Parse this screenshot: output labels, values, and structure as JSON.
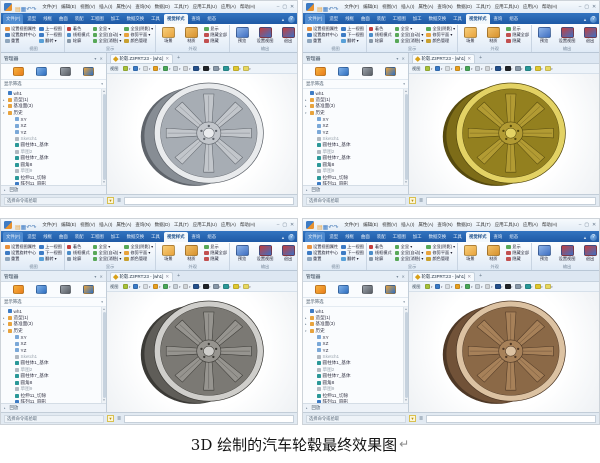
{
  "caption": {
    "text": "3D 绘制的汽车轮毂最终效果图",
    "return_mark": "↵"
  },
  "cad": {
    "quick_access": [
      {
        "name": "new-file-icon",
        "glyph": "▤",
        "color": "#e8a33d"
      },
      {
        "name": "save-icon",
        "glyph": "▦",
        "color": "#3d7bc4"
      },
      {
        "name": "undo-icon",
        "glyph": "↶",
        "color": "#4a7db8"
      },
      {
        "name": "redo-icon",
        "glyph": "↷",
        "color": "#4a7db8"
      }
    ],
    "menu": {
      "items": [
        "文件(F)",
        "编辑(E)",
        "视图(V)",
        "插入(I)",
        "属性(A)",
        "查询(N)",
        "数据(D)",
        "工具(T)",
        "应用工具(U)",
        "应用(A)",
        "帮助(H)"
      ]
    },
    "window_controls": [
      {
        "name": "minimize-button",
        "glyph": "–"
      },
      {
        "name": "maximize-button",
        "glyph": "▢"
      },
      {
        "name": "close-button",
        "glyph": "✕"
      }
    ],
    "ribbon_tabs": {
      "items": [
        "文件(F)",
        "造型",
        "线框",
        "曲面",
        "装配",
        "工程图",
        "加工",
        "数据交换",
        "工具",
        "视觉样式",
        "查询",
        "组态"
      ],
      "active_index": 9,
      "collapse_glyph": "▲",
      "help_glyph": "?"
    },
    "ribbon": {
      "groups": [
        {
          "label": "视图",
          "columns": [
            {
              "buttons": [
                {
                  "label": "设置视图属性",
                  "icon": "#e8913d"
                },
                {
                  "label": "设置旋转中心",
                  "icon": "#3d7bc4"
                },
                {
                  "label": "重置",
                  "icon": "#8fa6bd"
                }
              ]
            },
            {
              "buttons": [
                {
                  "label": "上一视图",
                  "icon": "#3d7bc4"
                },
                {
                  "label": "下一视图",
                  "icon": "#3d7bc4"
                },
                {
                  "label": "翻转 ▾",
                  "icon": "#58a0d8"
                }
              ]
            }
          ]
        },
        {
          "label": "显示",
          "columns": [
            {
              "buttons": [
                {
                  "label": "着色",
                  "icon": "#c23d3d"
                },
                {
                  "label": "线框模式",
                  "icon": "#4a8cc8"
                },
                {
                  "label": "轮廓",
                  "icon": "#8898a8"
                }
              ]
            },
            {
              "buttons": [
                {
                  "label": "全显 ▾",
                  "icon": "#58a858"
                },
                {
                  "label": "全显(自动) ▾",
                  "icon": "#58a858"
                },
                {
                  "label": "全显(消隐) ▾",
                  "icon": "#58a858"
                }
              ]
            },
            {
              "buttons": [
                {
                  "label": "全显(阴影) ▾",
                  "icon": "#58a858"
                },
                {
                  "label": "修剪平面 ▾",
                  "icon": "#e8a33d"
                },
                {
                  "label": "颜色管理",
                  "icon": "#c8a030"
                }
              ]
            }
          ]
        },
        {
          "label": "外观",
          "big": [
            {
              "label": "场景",
              "color": "#e8a33d",
              "color2": "#f7cf7a"
            },
            {
              "label": "材质",
              "color": "#d8922d",
              "color2": "#f0c068"
            }
          ],
          "columns": [
            {
              "buttons": [
                {
                  "label": "显示",
                  "icon": "#58a858"
                },
                {
                  "label": "隐藏全部",
                  "icon": "#c25050"
                },
                {
                  "label": "隐藏",
                  "icon": "#c25050"
                }
              ]
            }
          ]
        },
        {
          "label": "输出",
          "big": [
            {
              "label": "预览",
              "color": "#3f6fc2",
              "color2": "#8fb4e8"
            },
            {
              "label": "设置视图",
              "color": "#3f6fc2",
              "color2": "#c24040"
            },
            {
              "label": "退出",
              "color": "#3f6fc2",
              "color2": "#c24040"
            }
          ]
        }
      ]
    },
    "doc_tab": {
      "title": "轮毂.Z3PRT:23 - [wh1]",
      "close_glyph": "✕",
      "add_glyph": "+"
    },
    "viewport_toolbar": {
      "label": "视图",
      "icons": [
        {
          "name": "shade-mode-icon",
          "color": "#a8c23a"
        },
        {
          "name": "view-orientation-icon",
          "color": "#3a7bc8"
        },
        {
          "name": "wireframe-icon",
          "color": "#d8dde2"
        },
        {
          "name": "light-icon",
          "color": "#e8a020"
        },
        {
          "name": "background-icon",
          "color": "#4aa85a"
        },
        {
          "name": "frame-icon",
          "color": "#c8d0d8"
        },
        {
          "name": "sketch-edit-icon",
          "color": "#d0d4d8"
        },
        {
          "name": "section-view-icon",
          "color": "#24508c"
        },
        {
          "name": "screen-icon",
          "color": "#202428"
        },
        {
          "name": "grid-icon",
          "color": "#8898a8"
        },
        {
          "name": "globe-icon",
          "color": "#2a9898"
        },
        {
          "name": "snap-point-icon",
          "color": "#e0c830"
        },
        {
          "name": "snap-point-alt-icon",
          "color": "#e8d860"
        }
      ],
      "caret_glyph": "▾"
    },
    "manager": {
      "title": "管理器",
      "pin_glyph": "▾",
      "close_glyph": "✕",
      "icons": [
        {
          "name": "history-manager-icon",
          "color": "#e87d1e",
          "color2": "#f7b23c"
        },
        {
          "name": "assembly-manager-icon",
          "color": "#2f6fc0",
          "color2": "#7fb0e8"
        },
        {
          "name": "view-manager-icon",
          "color": "#5a5f66",
          "color2": "#9aa0a8"
        },
        {
          "name": "visual-manager-icon",
          "color": "#2f6fc0",
          "color2": "#e8a33d"
        }
      ],
      "filter_label": "显示筛选",
      "filter_caret_glyph": "▾",
      "tree": [
        {
          "label": "wh1",
          "icon": "part",
          "level": 0,
          "expand": ""
        },
        {
          "label": "造型(1)",
          "icon": "folder",
          "level": 0,
          "expand": "▸"
        },
        {
          "label": "基准面(3)",
          "icon": "folder",
          "level": 0,
          "expand": "▸"
        },
        {
          "label": "历史",
          "icon": "folder",
          "level": 0,
          "expand": "▾"
        },
        {
          "label": "XY",
          "icon": "plane",
          "level": 1,
          "expand": ""
        },
        {
          "label": "XZ",
          "icon": "plane",
          "level": 1,
          "expand": ""
        },
        {
          "label": "YZ",
          "icon": "plane",
          "level": 1,
          "expand": ""
        },
        {
          "label": "Sketch1",
          "icon": "sketch",
          "level": 1,
          "expand": "",
          "gray": true
        },
        {
          "label": "圆柱体1_基体",
          "icon": "feature",
          "level": 1,
          "expand": ""
        },
        {
          "label": "草图2",
          "icon": "sketch",
          "level": 1,
          "expand": "",
          "gray": true
        },
        {
          "label": "圆柱体7_基体",
          "icon": "feature",
          "level": 1,
          "expand": ""
        },
        {
          "label": "圆角8",
          "icon": "feature",
          "level": 1,
          "expand": ""
        },
        {
          "label": "草图9",
          "icon": "sketch",
          "level": 1,
          "expand": "",
          "gray": true
        },
        {
          "label": "拉伸11_切除",
          "icon": "cut",
          "level": 1,
          "expand": ""
        },
        {
          "label": "阵列11_圆形",
          "icon": "pattern",
          "level": 1,
          "expand": ""
        }
      ],
      "tree_icon_colors": {
        "part": "#3d7bc4",
        "folder": "#e8a33d",
        "plane": "#7aa8d8",
        "sketch": "#b0b8c0",
        "feature": "#2a9898",
        "cut": "#2a9898",
        "pattern": "#3d7bc4"
      },
      "scroll_up_glyph": "▲",
      "scroll_down_glyph": "▼",
      "replay_expand_glyph": "▸",
      "replay_label": "回放"
    },
    "status": {
      "hint": "选择命令或拾取",
      "filter_glyph": "▼",
      "list_glyph": "≣"
    }
  },
  "windows": [
    {
      "name": "cad-window-silver-wheel",
      "wheel": {
        "rim": "#e9ebed",
        "base": "#c2c6cb",
        "shadow": "#a7adb4",
        "dark": "#878d94",
        "deep": "#5f646b"
      }
    },
    {
      "name": "cad-window-gold-wheel",
      "wheel": {
        "rim": "#e3d264",
        "base": "#b29b33",
        "shadow": "#93801f",
        "dark": "#7d6c18",
        "deep": "#564a0e"
      }
    },
    {
      "name": "cad-window-gunmetal-wheel",
      "wheel": {
        "rim": "#cfcecb",
        "base": "#96948f",
        "shadow": "#7b7974",
        "dark": "#5f5d58",
        "deep": "#3b3a36"
      }
    },
    {
      "name": "cad-window-bronze-wheel",
      "wheel": {
        "rim": "#dcc2a2",
        "base": "#a78159",
        "shadow": "#8b6947",
        "dark": "#715238",
        "deep": "#4e3826"
      }
    }
  ]
}
